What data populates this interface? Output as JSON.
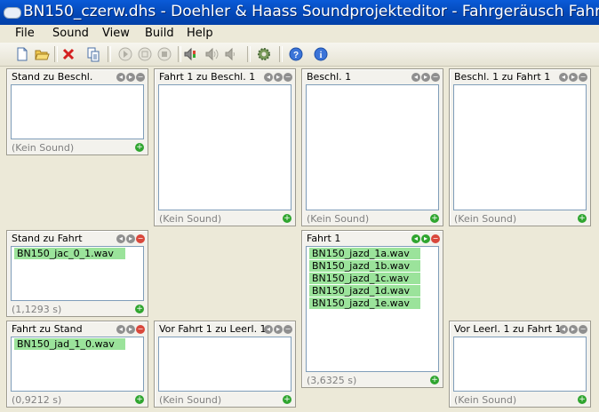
{
  "window": {
    "title": "BN150_czerw.dhs - Doehler & Haass Soundprojekteditor - Fahrgeräusch Fahrbe"
  },
  "menu": {
    "file": "File",
    "sound": "Sound",
    "view": "View",
    "build": "Build",
    "help": "Help"
  },
  "panels": {
    "stand_zu_beschl": {
      "title": "Stand zu Beschl.",
      "status": "(Kein Sound)"
    },
    "fahrt1_zu_beschl1": {
      "title": "Fahrt 1 zu Beschl. 1",
      "status": "(Kein Sound)"
    },
    "beschl1": {
      "title": "Beschl. 1",
      "status": "(Kein Sound)"
    },
    "beschl1_zu_fahrt1": {
      "title": "Beschl. 1 zu Fahrt 1",
      "status": "(Kein Sound)"
    },
    "stand_zu_fahrt": {
      "title": "Stand zu Fahrt",
      "files": [
        "BN150_jac_0_1.wav"
      ],
      "status": "(1,1293 s)"
    },
    "fahrt1": {
      "title": "Fahrt 1",
      "files": [
        "BN150_jazd_1a.wav",
        "BN150_jazd_1b.wav",
        "BN150_jazd_1c.wav",
        "BN150_jazd_1d.wav",
        "BN150_jazd_1e.wav"
      ],
      "status": "(3,6325 s)"
    },
    "fahrt_zu_stand": {
      "title": "Fahrt zu Stand",
      "files": [
        "BN150_jad_1_0.wav"
      ],
      "status": "(0,9212 s)"
    },
    "vor_fahrt1_zu_leerl1": {
      "title": "Vor Fahrt 1 zu Leerl. 1",
      "status": "(Kein Sound)"
    },
    "vor_leerl1_zu_fahrt1": {
      "title": "Vor Leerl. 1 zu Fahrt 1",
      "status": "(Kein Sound)"
    }
  }
}
